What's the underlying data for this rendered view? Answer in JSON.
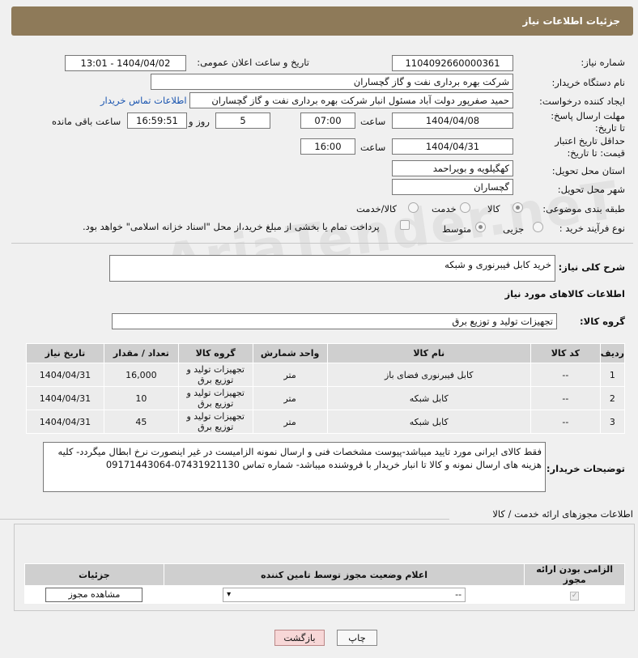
{
  "header": {
    "title": "جزئیات اطلاعات نیاز"
  },
  "form": {
    "need_number_label": "شماره نیاز:",
    "need_number": "1104092660000361",
    "announce_label": "تاریخ و ساعت اعلان عمومی:",
    "announce_value": "1404/04/02 - 13:01",
    "buyer_org_label": "نام دستگاه خریدار:",
    "buyer_org": "شرکت بهره برداری نفت و گاز گچساران",
    "creator_label": "ایجاد کننده درخواست:",
    "creator": "حمید  صفرپور دولت آباد مسئول انبار شرکت بهره برداری نفت و گاز گچساران",
    "contact_link": "اطلاعات تماس خریدار",
    "deadline_label": "مهلت ارسال پاسخ: تا تاریخ:",
    "deadline_date": "1404/04/08",
    "time_label": "ساعت",
    "deadline_time": "07:00",
    "days": "5",
    "days_label": "روز و",
    "remaining_time": "16:59:51",
    "remaining_label": "ساعت باقی مانده",
    "price_validity_label": "حداقل تاریخ اعتبار قیمت: تا تاریخ:",
    "price_validity_date": "1404/04/31",
    "price_validity_time": "16:00",
    "province_label": "استان محل تحویل:",
    "province": "کهگیلویه و بویراحمد",
    "city_label": "شهر محل تحویل:",
    "city": "گچساران",
    "category_label": "طبقه بندی موضوعی:",
    "category_options": [
      "کالا",
      "خدمت",
      "کالا/خدمت"
    ],
    "process_label": "نوع فرآیند خرید :",
    "process_options": [
      "جزیی",
      "متوسط"
    ],
    "payment_note": "پرداخت تمام یا بخشی از مبلغ خرید،از محل \"اسناد خزانه اسلامی\" خواهد بود."
  },
  "description": {
    "label": "شرح کلی نیاز:",
    "value": "خرید کابل فیبرنوری و شبکه"
  },
  "goods_section": {
    "title": "اطلاعات کالاهای مورد نیاز",
    "group_label": "گروه کالا:",
    "group_value": "تجهیزات تولید و توزیع برق"
  },
  "items_table": {
    "headers": [
      "ردیف",
      "کد کالا",
      "نام کالا",
      "واحد شمارش",
      "گروه کالا",
      "تعداد / مقدار",
      "تاریخ نیاز"
    ],
    "rows": [
      [
        "1",
        "--",
        "کابل فیبرنوری فضای باز",
        "متر",
        "تجهیزات تولید و توزیع برق",
        "16,000",
        "1404/04/31"
      ],
      [
        "2",
        "--",
        "کابل شبکه",
        "متر",
        "تجهیزات تولید و توزیع برق",
        "10",
        "1404/04/31"
      ],
      [
        "3",
        "--",
        "کابل شبکه",
        "متر",
        "تجهیزات تولید و توزیع برق",
        "45",
        "1404/04/31"
      ]
    ]
  },
  "buyer_notes": {
    "label": "توضیحات خریدار:",
    "value": "فقط کالای ایرانی مورد تایید میباشد-پیوست مشخصات فنی و ارسال نمونه الزامیست در غیر اینصورت نرخ ابطال میگردد- کلیه هزینه های ارسال نمونه و  کالا  تا انبار خریدار با فروشنده میباشد- شماره تماس 07431921130-09171443064"
  },
  "permits": {
    "title": "اطلاعات مجوزهای ارائه خدمت / کالا",
    "headers": [
      "الزامی بودن ارائه مجوز",
      "اعلام وضعیت مجوز توسط تامین کننده",
      "جزئیات"
    ],
    "select_value": "--",
    "view_button": "مشاهده مجوز"
  },
  "footer": {
    "print_button": "چاپ",
    "back_button": "بازگشت"
  },
  "watermark": "AriaTender.neT",
  "colors": {
    "header_bg": "#8e7a59",
    "link": "#1a55b0",
    "back_button_bg": "#f7d7d7"
  }
}
